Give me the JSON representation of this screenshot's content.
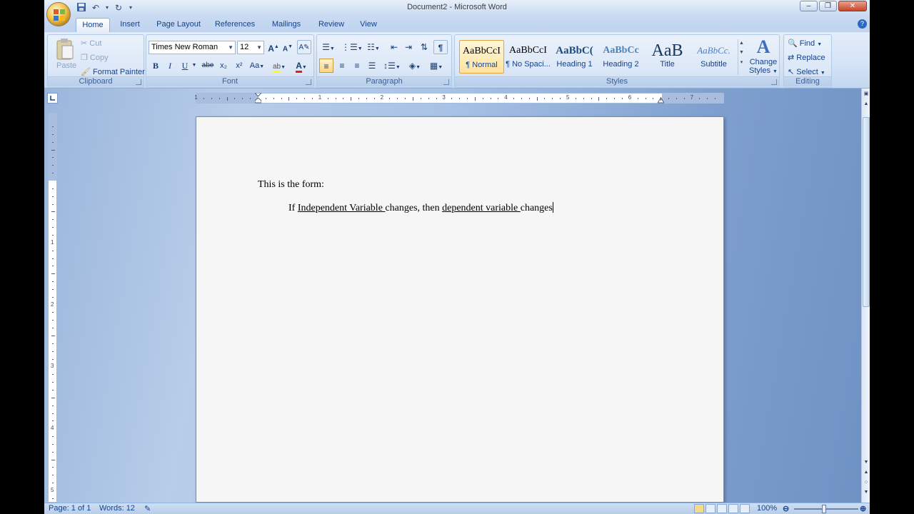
{
  "window": {
    "title": "Document2 - Microsoft Word",
    "controls": {
      "minimize": "–",
      "restore": "❐",
      "close": "✕"
    }
  },
  "quick_access": [
    "save-icon",
    "undo-icon",
    "redo-icon",
    "customize-icon"
  ],
  "tabs": [
    "Home",
    "Insert",
    "Page Layout",
    "References",
    "Mailings",
    "Review",
    "View"
  ],
  "active_tab": "Home",
  "ribbon": {
    "clipboard": {
      "label": "Clipboard",
      "paste": "Paste",
      "cut": "Cut",
      "copy": "Copy",
      "format_painter": "Format Painter"
    },
    "font": {
      "label": "Font",
      "font_name": "Times New Roman",
      "font_size": "12",
      "bold": "B",
      "italic": "I",
      "underline": "U",
      "strike": "abe",
      "subscript": "x₂",
      "superscript": "x²",
      "change_case": "Aa"
    },
    "paragraph": {
      "label": "Paragraph"
    },
    "styles": {
      "label": "Styles",
      "items": [
        {
          "sample": "AaBbCcI",
          "name": "¶ Normal"
        },
        {
          "sample": "AaBbCcI",
          "name": "¶ No Spaci..."
        },
        {
          "sample": "AaBbC(",
          "name": "Heading 1"
        },
        {
          "sample": "AaBbCc",
          "name": "Heading 2"
        },
        {
          "sample": "AaB",
          "name": "Title"
        },
        {
          "sample": "AaBbCc.",
          "name": "Subtitle"
        }
      ],
      "change_styles": [
        "Change",
        "Styles"
      ]
    },
    "editing": {
      "label": "Editing",
      "find": "Find",
      "replace": "Replace",
      "select": "Select"
    }
  },
  "ruler": {
    "h_numbers": [
      "1",
      "1",
      "2",
      "3",
      "4",
      "5",
      "6",
      "7"
    ],
    "v_numbers": [
      "1",
      "2",
      "3",
      "4",
      "5"
    ]
  },
  "document": {
    "line1": "This is the form:",
    "line2_prefix": "If ",
    "line2_iv": "Independent Variable ",
    "line2_mid": "changes, then ",
    "line2_dv": "dependent variable ",
    "line2_end": "changes"
  },
  "status": {
    "page": "Page: 1 of 1",
    "words": "Words: 12",
    "zoom": "100%"
  }
}
